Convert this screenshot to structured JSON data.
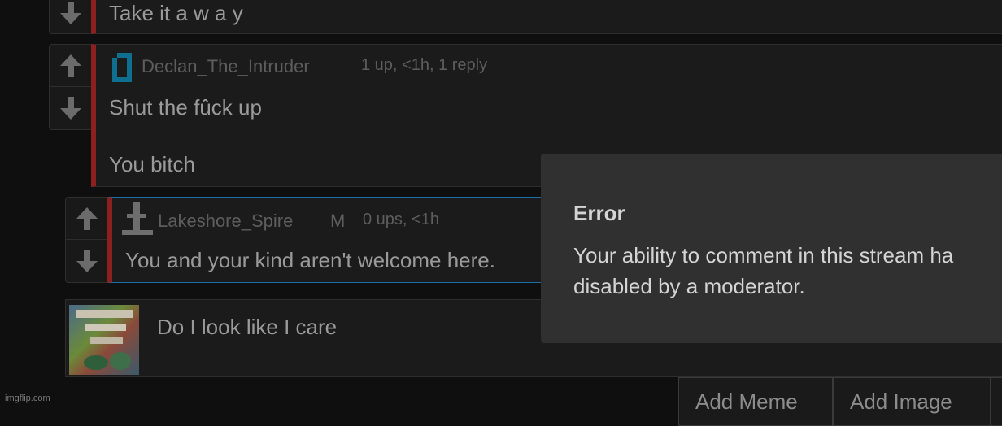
{
  "comments": [
    {
      "text": "Take it a w a y"
    },
    {
      "username": "Declan_The_Intruder",
      "meta": "1 up, <1h, 1 reply",
      "lines": [
        "Shut the fûck up",
        "You bitch"
      ]
    },
    {
      "username": "Lakeshore_Spire",
      "mod_badge": "M",
      "meta": "0 ups, <1h",
      "text": "You and your kind aren't welcome here."
    },
    {
      "text": "Do I look like I care"
    }
  ],
  "error_modal": {
    "title": "Error",
    "message_line1": "Your ability to comment in this stream ha",
    "message_line2": "disabled by a moderator."
  },
  "buttons": {
    "add_meme": "Add Meme",
    "add_image": "Add Image"
  },
  "watermark": "imgflip.com",
  "colors": {
    "background": "#0f0f0f",
    "comment_bg": "#1b1b1b",
    "accent_red": "#8c1f1f",
    "accent_blue": "#1e6ea8",
    "modal_bg": "#303030"
  },
  "icons": [
    "up-arrow-icon",
    "down-arrow-icon",
    "user-avatar-icon"
  ]
}
